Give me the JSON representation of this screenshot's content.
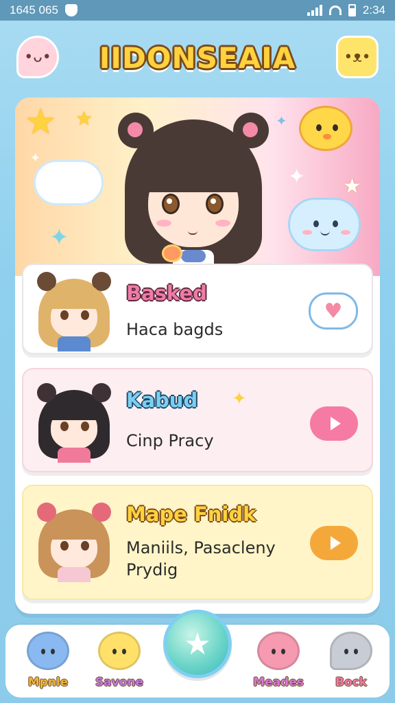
{
  "status_bar": {
    "left_text": "1645 065",
    "right_text": "2:34"
  },
  "header": {
    "title": "IIDONSEAIA"
  },
  "list": [
    {
      "title": "Basked",
      "subtitle": "Haca bagds"
    },
    {
      "title": "Kabud",
      "subtitle": "Cinp Pracy"
    },
    {
      "title": "Mape Fnidk",
      "subtitle_line1": "Maniils, Pasacleny",
      "subtitle_line2": "Prydig"
    }
  ],
  "nav": [
    {
      "label": "Mpnle",
      "color": "#f0b43a"
    },
    {
      "label": "Savone",
      "color": "#c47ae0"
    },
    {
      "label": "Meades",
      "color": "#d67ad0"
    },
    {
      "label": "Bock",
      "color": "#f07aa8"
    }
  ],
  "icons": {
    "header_left": "chat-bubble-face-icon",
    "header_right": "mascot-icon",
    "card1_action": "heart-bubble-icon",
    "card2_action": "play-icon",
    "card3_action": "play-icon",
    "nav_center": "star-icon"
  },
  "colors": {
    "title_fill": "#ffd23e",
    "card1_title": "#f07aa8",
    "card2_title": "#7ccff0",
    "card3_title": "#ffd23e",
    "play_pink": "#f57aa4",
    "play_orange": "#f5a83a"
  }
}
